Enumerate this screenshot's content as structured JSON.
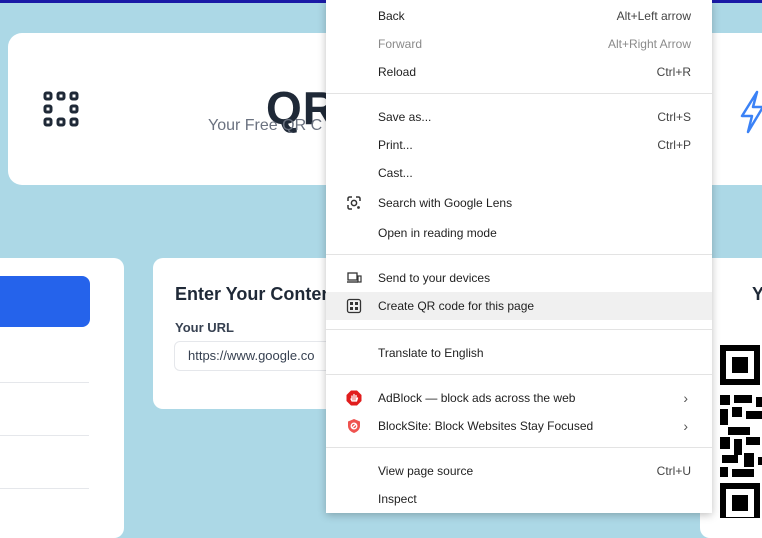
{
  "hero": {
    "title": "QR",
    "subtitle": "Your Free QR C"
  },
  "content_panel": {
    "title": "Enter Your Conten",
    "url_label": "Your URL",
    "url_value": "https://www.google.co"
  },
  "right_panel": {
    "heading": "Y"
  },
  "context_menu": {
    "back": {
      "label": "Back",
      "shortcut": "Alt+Left arrow"
    },
    "forward": {
      "label": "Forward",
      "shortcut": "Alt+Right Arrow"
    },
    "reload": {
      "label": "Reload",
      "shortcut": "Ctrl+R"
    },
    "save_as": {
      "label": "Save as...",
      "shortcut": "Ctrl+S"
    },
    "print": {
      "label": "Print...",
      "shortcut": "Ctrl+P"
    },
    "cast": {
      "label": "Cast..."
    },
    "lens": {
      "label": "Search with Google Lens"
    },
    "reading_mode": {
      "label": "Open in reading mode"
    },
    "send_devices": {
      "label": "Send to your devices"
    },
    "create_qr": {
      "label": "Create QR code for this page"
    },
    "translate": {
      "label": "Translate to English"
    },
    "adblock": {
      "label": "AdBlock — block ads across the web"
    },
    "blocksite": {
      "label": "BlockSite: Block Websites  Stay Focused"
    },
    "view_source": {
      "label": "View page source",
      "shortcut": "Ctrl+U"
    },
    "inspect": {
      "label": "Inspect"
    }
  },
  "colors": {
    "background": "#acd8e6",
    "accent_blue": "#2563eb",
    "adblock_red": "#e11d1d",
    "blocksite_red": "#ef5350"
  }
}
